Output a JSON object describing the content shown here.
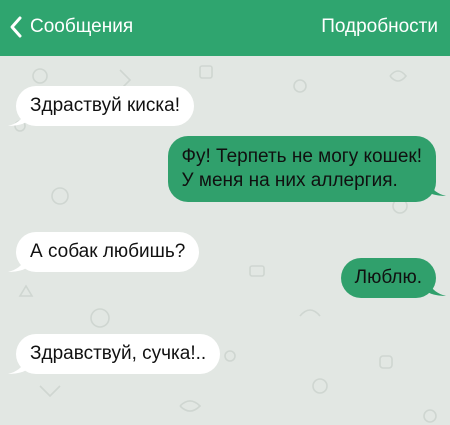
{
  "colors": {
    "nav_bar": "#2fa56f",
    "background": "#e2e7e3",
    "incoming_bubble": "#ffffff",
    "outgoing_bubble": "#30a06c",
    "doodle_pattern": "#cfd6d1"
  },
  "nav": {
    "back_icon": "chevron-left-icon",
    "back_label": "Сообщения",
    "details_label": "Подробности"
  },
  "messages": [
    {
      "direction": "incoming",
      "lines": [
        "Здраствуй киска!"
      ]
    },
    {
      "direction": "outgoing",
      "lines": [
        "Фу! Терпеть не могу кошек!",
        "У меня на них аллергия."
      ]
    },
    {
      "direction": "incoming",
      "lines": [
        "А собак любишь?"
      ]
    },
    {
      "direction": "outgoing",
      "lines": [
        "Люблю."
      ]
    },
    {
      "direction": "incoming",
      "lines": [
        "Здравствуй, сучка!.."
      ]
    }
  ]
}
